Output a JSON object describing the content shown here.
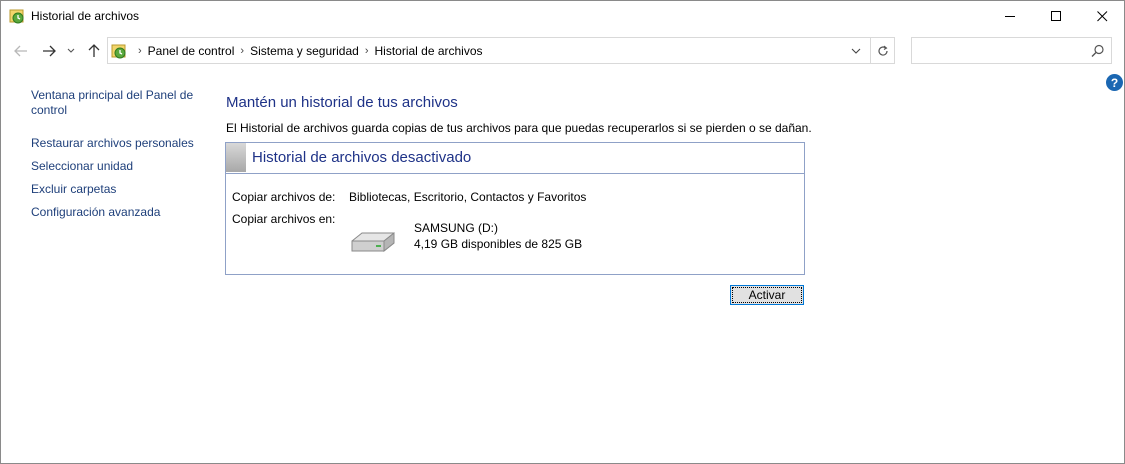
{
  "window": {
    "title": "Historial de archivos"
  },
  "address": {
    "crumbs": [
      "Panel de control",
      "Sistema y seguridad",
      "Historial de archivos"
    ],
    "separator": "›"
  },
  "search": {
    "placeholder": ""
  },
  "sidebar": {
    "items": [
      {
        "label_line1": "Ventana principal del Panel de",
        "label_line2": "control"
      },
      {
        "label": "Restaurar archivos personales"
      },
      {
        "label": "Seleccionar unidad"
      },
      {
        "label": "Excluir carpetas"
      },
      {
        "label": "Configuración avanzada"
      }
    ]
  },
  "main": {
    "heading": "Mantén un historial de tus archivos",
    "description": "El Historial de archivos guarda copias de tus archivos para que puedas recuperarlos si se pierden o se dañan.",
    "panel": {
      "title": "Historial de archivos desactivado",
      "copy_from_label": "Copiar archivos de:",
      "copy_from_value": "Bibliotecas, Escritorio, Contactos y Favoritos",
      "copy_to_label": "Copiar archivos en:",
      "drive_name": "SAMSUNG (D:)",
      "drive_space": "4,19 GB disponibles de 825 GB"
    },
    "activate_button": "Activar"
  },
  "colors": {
    "link": "#1e3f7a",
    "heading": "#1e3287",
    "panel_border": "#8fa1c7",
    "help": "#1b67b2"
  }
}
